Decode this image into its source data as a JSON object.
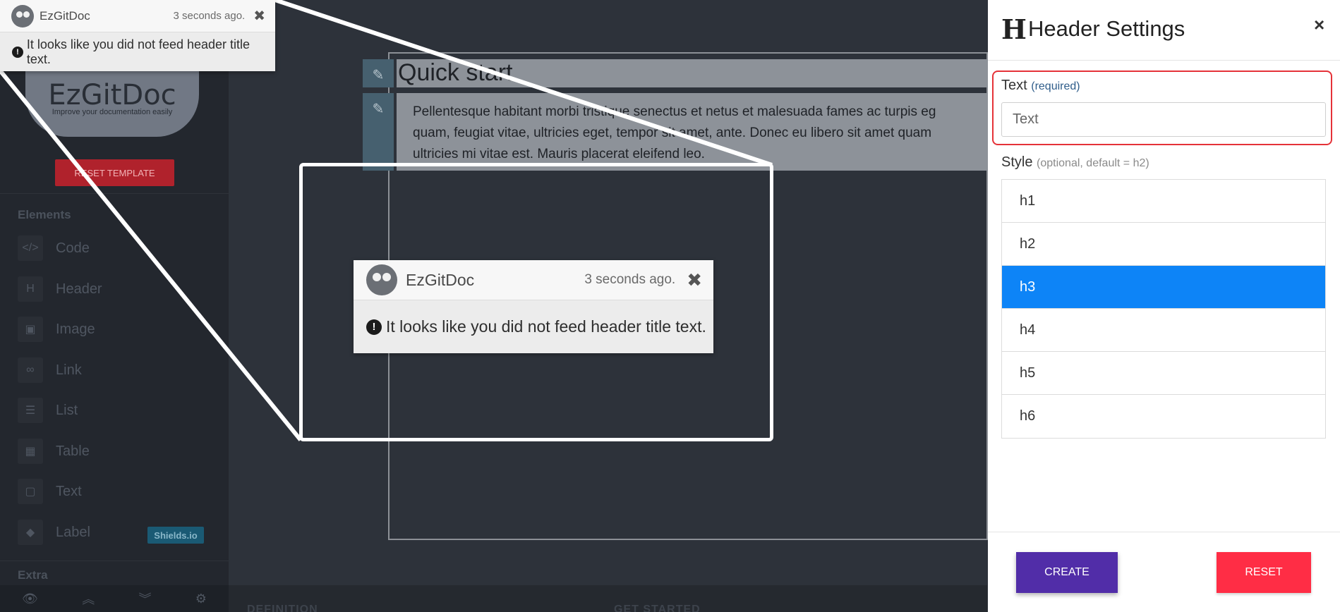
{
  "sidebar": {
    "logo_text": "EzGitDoc",
    "logo_tagline": "Improve your documentation easily",
    "reset_template_label": "RESET TEMPLATE",
    "elements_heading": "Elements",
    "items": [
      {
        "icon": "code-icon",
        "glyph": "</>",
        "label": "Code"
      },
      {
        "icon": "header-icon",
        "glyph": "H",
        "label": "Header"
      },
      {
        "icon": "image-icon",
        "glyph": "▣",
        "label": "Image"
      },
      {
        "icon": "link-icon",
        "glyph": "∞",
        "label": "Link"
      },
      {
        "icon": "list-icon",
        "glyph": "☰",
        "label": "List"
      },
      {
        "icon": "table-icon",
        "glyph": "▦",
        "label": "Table"
      },
      {
        "icon": "text-icon",
        "glyph": "▢",
        "label": "Text"
      },
      {
        "icon": "tag-icon",
        "glyph": "◆",
        "label": "Label"
      }
    ],
    "shields_badge": "Shields.io",
    "extra_heading": "Extra",
    "bottom_icons": [
      "eye-icon",
      "double-chevron-up-icon",
      "double-chevron-down-icon",
      "gear-icon"
    ]
  },
  "editor": {
    "header_title": "Quick start",
    "paragraph_lines": [
      "Pellentesque habitant morbi tristique senectus et netus et malesuada fames ac turpis eg",
      "quam, feugiat vitae, ultricies eget, tempor sit amet, ante. Donec eu libero sit amet quam",
      "ultricies mi vitae est. Mauris placerat eleifend leo."
    ],
    "footer_left": "DEFINITION",
    "footer_mid": "GET STARTED"
  },
  "toast": {
    "app_name": "EzGitDoc",
    "time": "3 seconds ago.",
    "close_glyph": "✖",
    "warn_glyph": "!",
    "message": "It looks like you did not feed header title text."
  },
  "panel": {
    "icon_glyph": "H",
    "title": "Header Settings",
    "close_glyph": "×",
    "text_label": "Text",
    "text_hint": "(required)",
    "text_placeholder": "Text",
    "style_label": "Style",
    "style_hint": "(optional, default = h2)",
    "style_options": [
      "h1",
      "h2",
      "h3",
      "h4",
      "h5",
      "h6"
    ],
    "selected_style": "h3",
    "create_label": "CREATE",
    "reset_label": "RESET",
    "accent_selected": "#0d84f7",
    "create_color": "#512da8",
    "reset_color": "#ff2d45",
    "error_outline": "#e53238"
  }
}
